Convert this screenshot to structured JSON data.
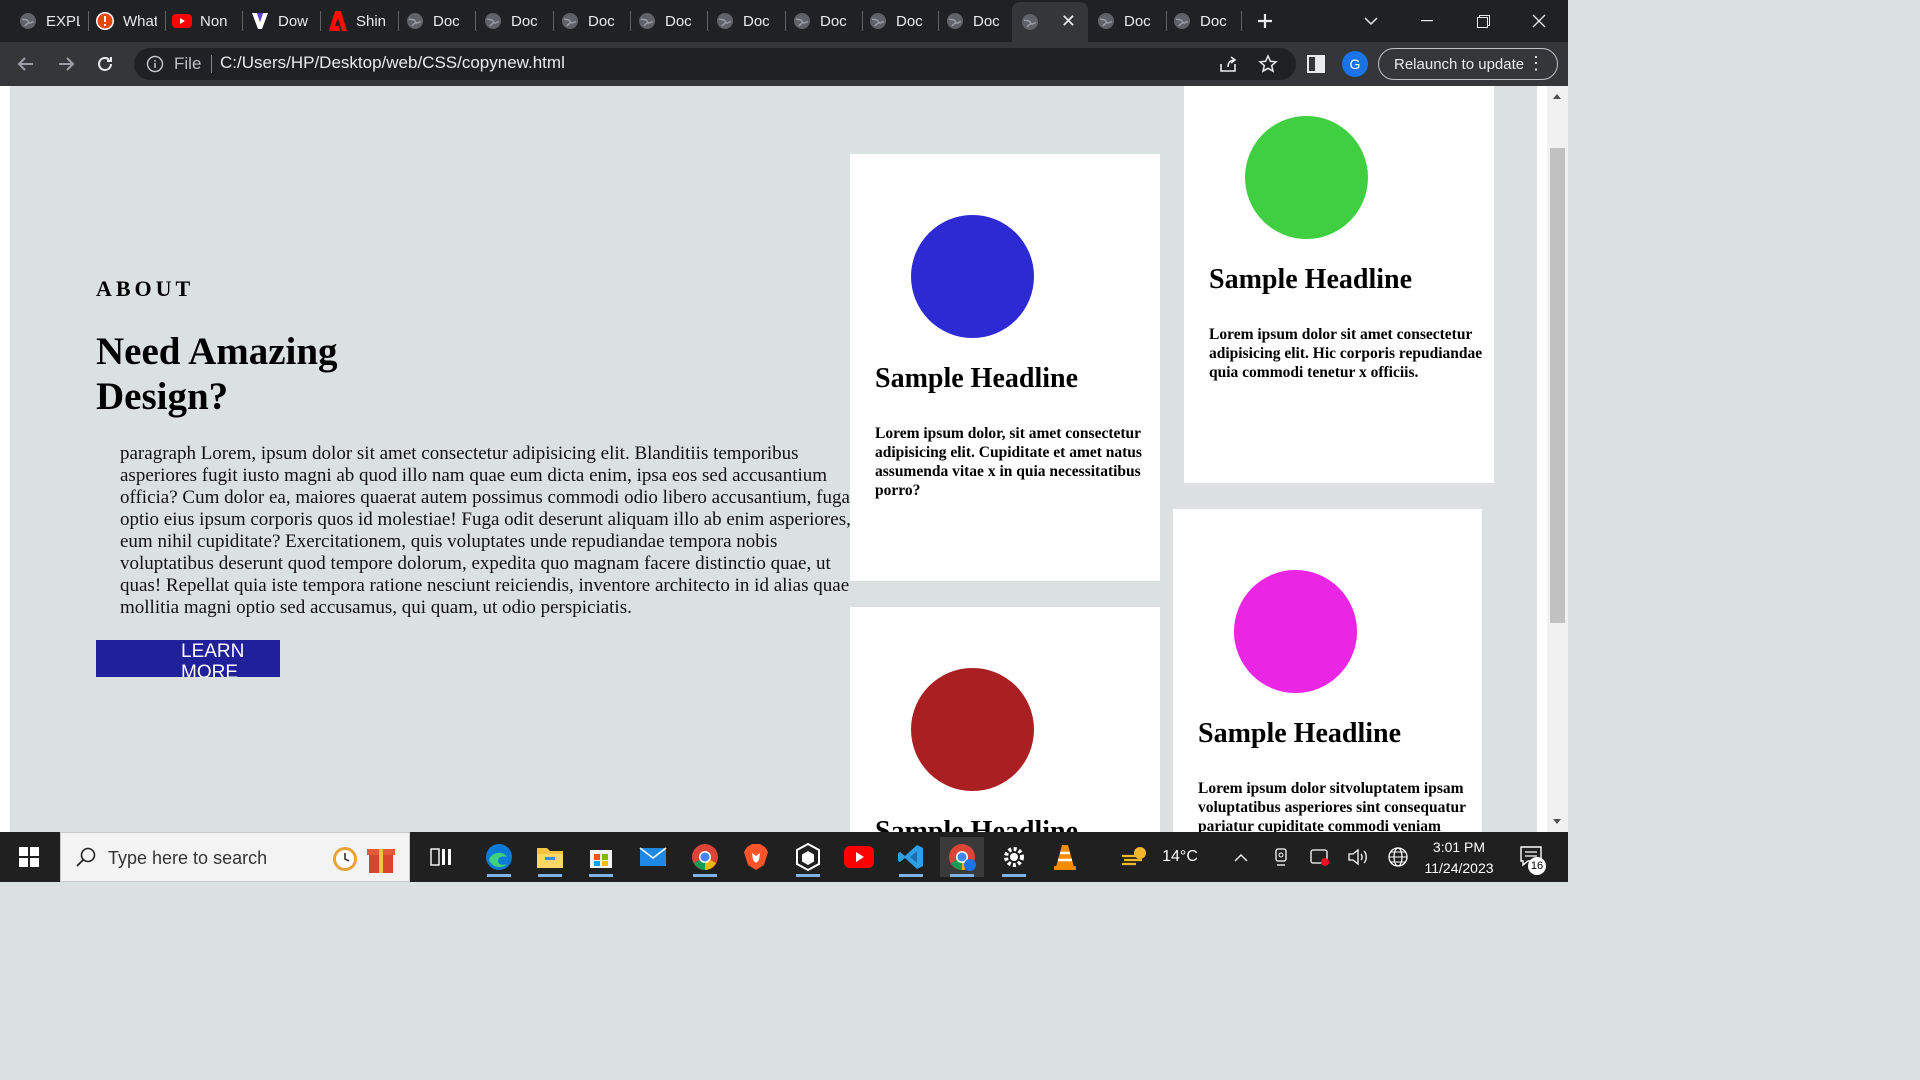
{
  "browser": {
    "tabs": [
      {
        "title": "EXPL",
        "icon": "globe-icon"
      },
      {
        "title": "What",
        "icon": "alert-icon"
      },
      {
        "title": "Non",
        "icon": "youtube-icon"
      },
      {
        "title": "Dow",
        "icon": "v-logo-icon"
      },
      {
        "title": "Shin",
        "icon": "adobe-icon"
      },
      {
        "title": "Doc",
        "icon": "globe-icon"
      },
      {
        "title": "Doc",
        "icon": "globe-icon"
      },
      {
        "title": "Doc",
        "icon": "globe-icon"
      },
      {
        "title": "Doc",
        "icon": "globe-icon"
      },
      {
        "title": "Doc",
        "icon": "globe-icon"
      },
      {
        "title": "Doc",
        "icon": "globe-icon"
      },
      {
        "title": "Doc",
        "icon": "globe-icon"
      },
      {
        "title": "Doc",
        "icon": "globe-icon"
      },
      {
        "title": "",
        "icon": "globe-icon",
        "active": true
      },
      {
        "title": "Doc",
        "icon": "globe-icon"
      },
      {
        "title": "Doc",
        "icon": "globe-icon"
      }
    ],
    "address": {
      "scheme_label": "File",
      "url": "C:/Users/HP/Desktop/web/CSS/copynew.html"
    },
    "profile_initial": "G",
    "relaunch_label": "Relaunch to update"
  },
  "page": {
    "eyebrow": "ABOUT",
    "headline": "Need Amazing Design?",
    "paragraph": "paragraph Lorem, ipsum dolor sit amet consectetur adipisicing elit. Blanditiis temporibus asperiores fugit iusto magni ab quod illo nam quae eum dicta enim, ipsa eos sed accusantium officia? Cum dolor ea, maiores quaerat autem possimus commodi odio libero accusantium, fuga optio eius ipsum corporis quos id molestiae! Fuga odit deserunt aliquam illo ab enim asperiores, eum nihil cupiditate? Exercitationem, quis voluptates unde repudiandae tempora nobis voluptatibus deserunt quod tempore dolorum, expedita quo magnam facere distinctio quae, ut quas! Repellat quia iste tempora ratione nesciunt reiciendis, inventore architecto in id alias quae mollitia magni optio sed accusamus, qui quam, ut odio perspiciatis.",
    "button_label": "LEARN MORE",
    "cards": [
      {
        "title": "Sample Headline",
        "text": "Lorem ipsum dolor, sit amet consectetur adipisicing elit. Cupiditate et amet natus assumenda vitae x in quia necessitatibus porro?",
        "circle_color": "#2d2ad4"
      },
      {
        "title": "Sample Headline",
        "text": "Lorem ipsum dolor sit amet consectetur adipisicing elit. Hic corporis repudiandae quia commodi tenetur x officiis.",
        "circle_color": "#3fcf41"
      },
      {
        "title": "Sample Headline",
        "text": "",
        "circle_color": "#a91f22"
      },
      {
        "title": "Sample Headline",
        "text": "Lorem ipsum dolor sitvoluptatem ipsam voluptatibus asperiores sint consequatur pariatur cupiditate commodi veniam",
        "circle_color": "#ea26e4"
      }
    ],
    "button_color": "#20209a",
    "background_color": "#dbe0e0"
  },
  "taskbar": {
    "search_placeholder": "Type here to search",
    "weather": "14°C",
    "time": "3:01 PM",
    "date": "11/24/2023",
    "notification_count": "16",
    "apps": [
      "task-view-icon",
      "edge-icon",
      "file-explorer-icon",
      "store-icon",
      "mail-icon",
      "chrome-icon",
      "brave-icon",
      "unity-icon",
      "youtube-icon",
      "vscode-icon",
      "chrome-profile-icon",
      "settings-icon",
      "vlc-icon"
    ]
  }
}
